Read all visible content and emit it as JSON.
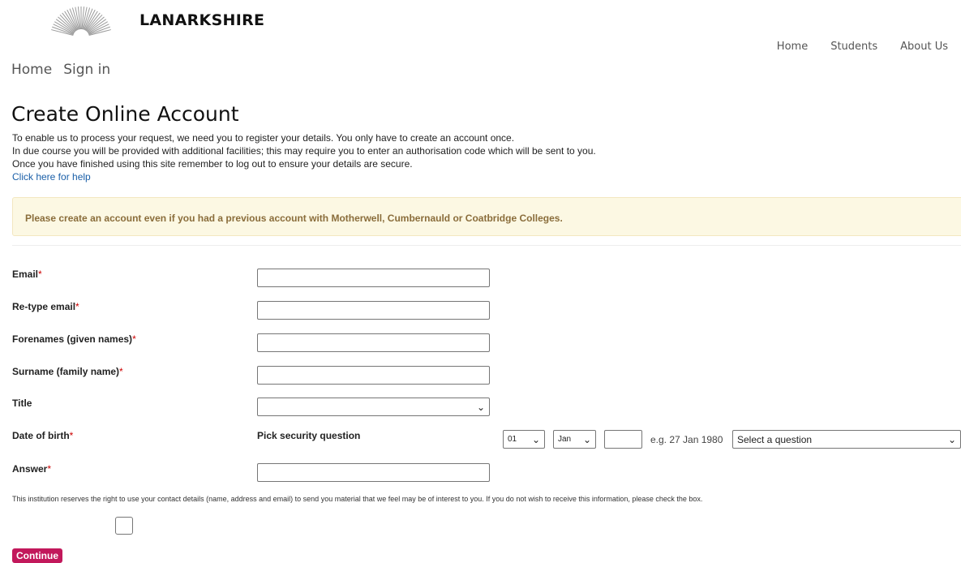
{
  "header": {
    "brand": "LANARKSHIRE",
    "nav": [
      {
        "label": "Home"
      },
      {
        "label": "Students"
      },
      {
        "label": "About Us"
      }
    ]
  },
  "breadcrumb": [
    {
      "label": "Home"
    },
    {
      "label": "Sign in"
    }
  ],
  "page": {
    "title": "Create Online Account",
    "intro": [
      "To enable us to process your request, we need you to register your details. You only have to create an account once.",
      "In due course you will be provided with additional facilities; this may require you to enter an authorisation code which will be sent to you.",
      "Once you have finished using this site remember to log out to ensure your details are secure."
    ],
    "help_link": "Click here for help",
    "notice": "Please create an account even if you had a previous account with Motherwell, Cumbernauld or Coatbridge Colleges."
  },
  "form": {
    "required_mark": "*",
    "email_label": "Email",
    "retype_email_label": "Re-type email",
    "forenames_label": "Forenames (given names)",
    "surname_label": "Surname (family name)",
    "title_label": "Title",
    "title_value": "",
    "dob_label": "Date of birth",
    "security_label": "Pick security question",
    "dob_day": "01",
    "dob_month": "Jan",
    "dob_year": "",
    "dob_hint": "e.g. 27 Jan 1980",
    "security_question": "Select a question",
    "answer_label": "Answer",
    "email_value": "",
    "retype_email_value": "",
    "forenames_value": "",
    "surname_value": "",
    "answer_value": ""
  },
  "disclaimer": "This institution reserves the right to use your contact details (name, address and email) to send you material that we feel may be of interest to you. If you do not wish to receive this information, please check the box.",
  "continue_label": "Continue",
  "colors": {
    "accent": "#c2185b",
    "notice_bg": "#fcf8e3",
    "notice_text": "#8a6d3b",
    "link": "#1a5fa8"
  },
  "icons": {
    "logo": "sunburst-logo-icon",
    "dropdown": "chevron-down-icon"
  }
}
